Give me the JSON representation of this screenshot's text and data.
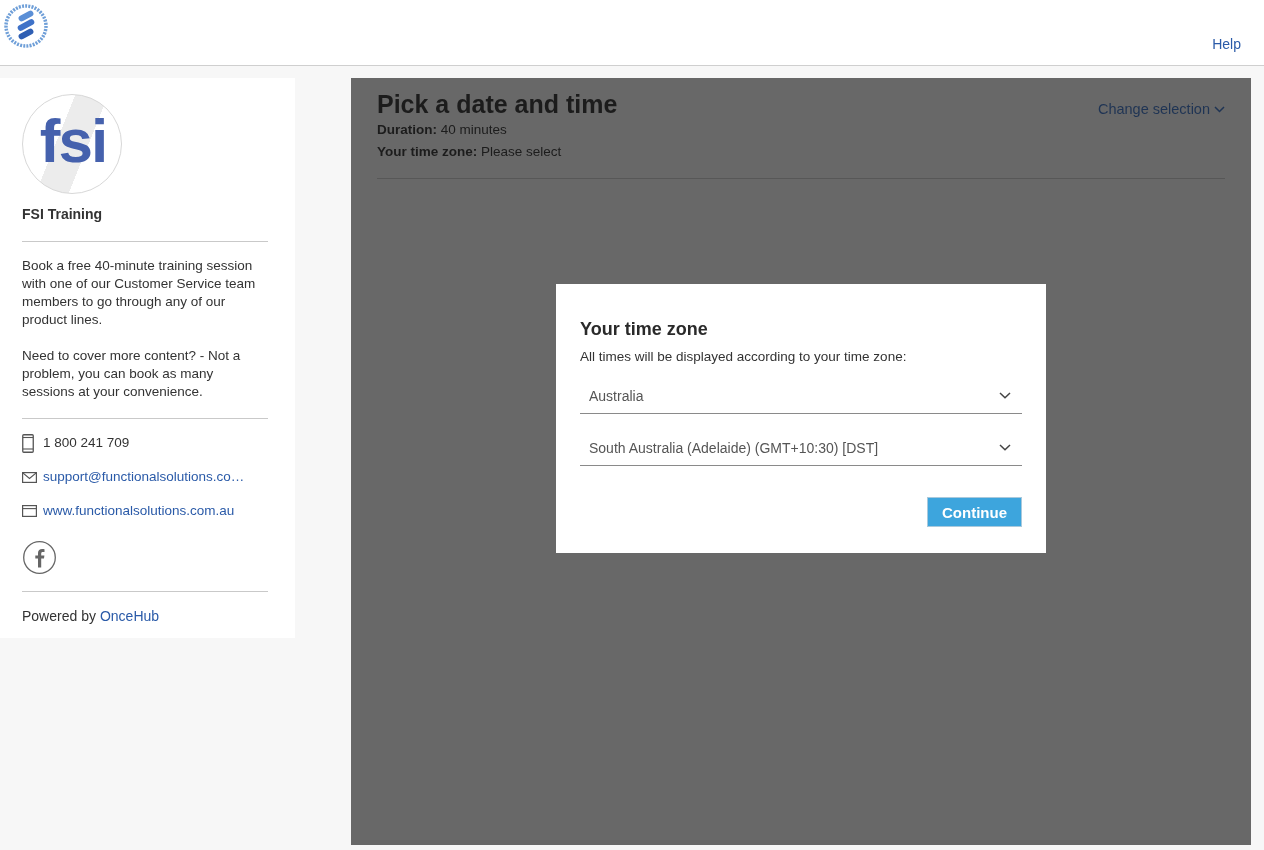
{
  "header": {
    "help_link": "Help"
  },
  "sidebar": {
    "logo_text": "fsi",
    "title": "FSI Training",
    "description": [
      "Book a free 40-minute training session with one of our Customer Service team members to go through any of our product lines.",
      "Need to cover more content? - Not a problem, you can book as many sessions at your convenience."
    ],
    "contacts": [
      {
        "kind": "phone",
        "text": "1 800 241 709"
      },
      {
        "kind": "email",
        "text": "support@functionalsolutions.co…"
      },
      {
        "kind": "website",
        "text": "www.functionalsolutions.com.au"
      }
    ],
    "powered_by": {
      "text": "Powered by",
      "link": "OnceHub"
    }
  },
  "main": {
    "title": "Pick a date and time",
    "details": [
      "**Duration:** 40 minutes",
      "**Your time zone:** Please select"
    ],
    "change_selection": "Change selection"
  },
  "dialog": {
    "title": "Your time zone",
    "subtitle": "All times will be displayed according to your time zone:",
    "selects": [
      {
        "value": "Australia"
      },
      {
        "value": "South Australia (Adelaide) (GMT+10:30) [DST]"
      }
    ],
    "button": "Continue"
  }
}
